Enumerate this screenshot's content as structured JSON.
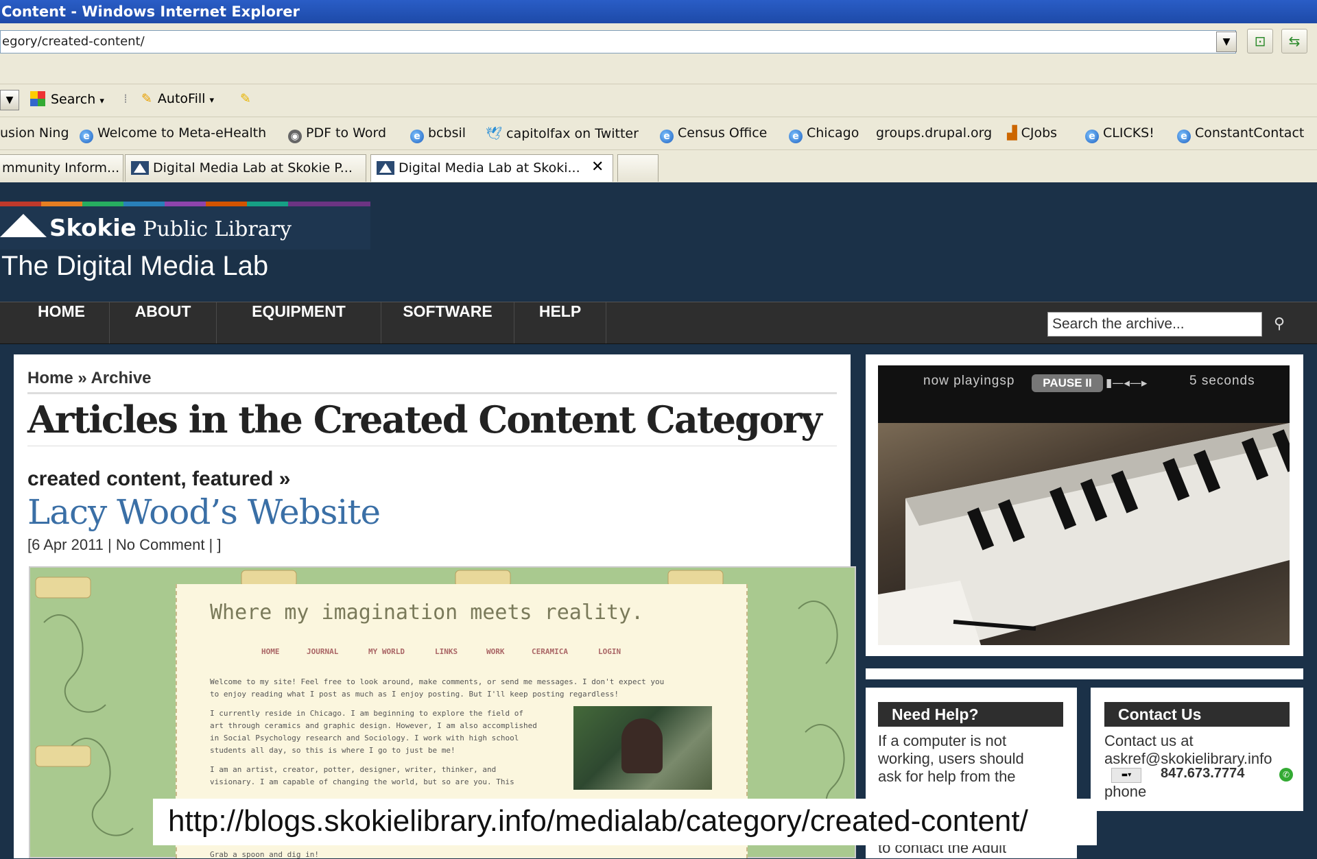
{
  "window": {
    "title": "Content - Windows Internet Explorer"
  },
  "address": {
    "url": "egory/created-content/"
  },
  "toolbar": {
    "search_label": "Search",
    "autofill_label": "AutoFill"
  },
  "favorites": [
    "usion Ning",
    "Welcome to Meta-eHealth",
    "PDF to Word",
    "bcbsil",
    "capitolfax on Twitter",
    "Census Office",
    "Chicago",
    "groups.drupal.org",
    "CJobs",
    "CLICKS!",
    "ConstantContact"
  ],
  "tabs": [
    "mmunity Inform...",
    "Digital Media Lab at Skokie P...",
    "Digital Media Lab at Skoki..."
  ],
  "site": {
    "library_name_bold": "Skokie",
    "library_name_rest": " Public Library",
    "subtitle": "The Digital Media Lab",
    "nav": [
      "HOME",
      "ABOUT",
      "EQUIPMENT",
      "SOFTWARE",
      "HELP"
    ],
    "search_placeholder": "Search the archive...",
    "colors": {
      "header_bg": "#1b3148",
      "nav_bg": "#2e2e2e",
      "link": "#3a6fa6"
    }
  },
  "main": {
    "breadcrumb": "Home » Archive",
    "heading": "Articles in the Created Content Category",
    "post": {
      "categories": "created content, featured »",
      "title": "Lacy Wood’s Website",
      "meta": "[6 Apr 2011 | No Comment | ]"
    },
    "screenshot": {
      "tagline": "Where my imagination meets reality.",
      "nav": [
        "HOME",
        "JOURNAL",
        "MY WORLD",
        "LINKS",
        "WORK",
        "CERAMICA",
        "LOGIN"
      ],
      "p1a": "Welcome to my site! Feel free to look around, make comments, or send me messages. I don't expect you",
      "p1b": "to enjoy reading what I post as much as I enjoy posting. But I'll keep posting regardless!",
      "p2a": "I currently reside in Chicago. I am beginning to explore the field of",
      "p2b": "art through ceramics and graphic design. However, I am also accomplished",
      "p2c": "in Social Psychology research and Sociology. I work with high school",
      "p2d": "students all day, so this is where I go to just be me!",
      "p3a": "I am an artist, creator, potter, designer, writer, thinker, and",
      "p3b": "visionary. I am capable of changing the world, but so are you. This",
      "p4": "Grab a spoon and dig in!"
    }
  },
  "slideshow": {
    "now_playing": "now playingsp",
    "pause_label": "PAUSE II",
    "interval": "5 seconds"
  },
  "help": {
    "title": "Need Help?",
    "text1": "If a computer is not",
    "text2": "working, users should",
    "text3": "ask for help from the",
    "text4": "to contact the Adult"
  },
  "contact": {
    "title": "Contact Us",
    "line1": "Contact us at",
    "email": "askref@skokielibrary.info",
    "phone": "847.673.7774",
    "phone_label": "phone"
  },
  "caption": {
    "url": "http://blogs.skokielibrary.info/medialab/category/created-content/"
  }
}
